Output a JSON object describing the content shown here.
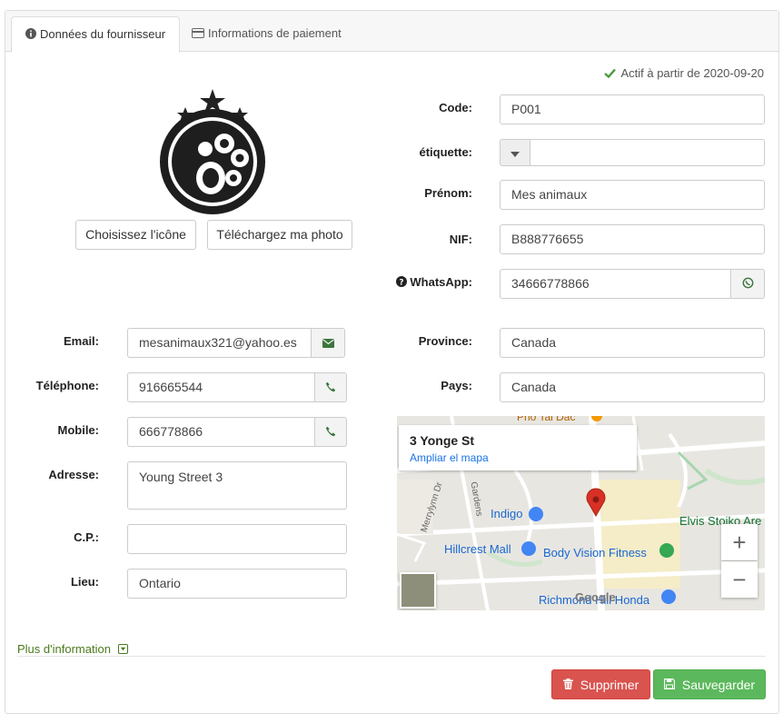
{
  "tabs": [
    {
      "label": "Données du fournisseur",
      "icon": "info-circle-icon",
      "active": true
    },
    {
      "label": "Informations de paiement",
      "icon": "credit-card-icon",
      "active": false
    }
  ],
  "status": {
    "text": "Actif à partir de 2020-09-20",
    "icon": "check-icon",
    "color": "#5cb85c"
  },
  "avatar": {
    "icon": "paw-star-logo-icon"
  },
  "photo_buttons": {
    "choose_icon": "Choisissez l'icône",
    "upload_photo": "Téléchargez ma photo"
  },
  "right_form": {
    "code": {
      "label": "Code:",
      "value": "P001"
    },
    "tag": {
      "label": "étiquette:",
      "value": ""
    },
    "firstname": {
      "label": "Prénom:",
      "value": "Mes animaux"
    },
    "nif": {
      "label": "NIF:",
      "value": "B888776655"
    },
    "whatsapp": {
      "label": "WhatsApp:",
      "value": "34666778866",
      "help_icon": "question-circle-icon",
      "icon": "whatsapp-icon"
    },
    "province": {
      "label": "Province:",
      "value": "Canada"
    },
    "country": {
      "label": "Pays:",
      "value": "Canada"
    }
  },
  "left_form": {
    "email": {
      "label": "Email:",
      "value": "mesanimaux321@yahoo.es",
      "icon": "envelope-icon"
    },
    "phone": {
      "label": "Téléphone:",
      "value": "916665544",
      "icon": "phone-icon"
    },
    "mobile": {
      "label": "Mobile:",
      "value": "666778866",
      "icon": "phone-icon"
    },
    "address": {
      "label": "Adresse:",
      "value": "Young Street 3"
    },
    "zip": {
      "label": "C.P.:",
      "value": ""
    },
    "city": {
      "label": "Lieu:",
      "value": "Ontario"
    }
  },
  "map": {
    "place_title": "3 Yonge St",
    "enlarge_link": "Ampliar el mapa",
    "labels": {
      "indigo": "Indigo",
      "hillcrest": "Hillcrest Mall",
      "body_vision": "Body Vision Fitness",
      "elvis": "Elvis Stoiko Are",
      "richmond": "Richmond Hill Honda",
      "merrylynn": "Merrylynn Dr",
      "garden": "Gardens",
      "pho": "Pho Tai Dac",
      "google": "Google"
    },
    "zoom_in": "+",
    "zoom_out": "−"
  },
  "more_info": {
    "label": "Plus d'information",
    "icon": "caret-down-square-icon"
  },
  "actions": {
    "delete": "Supprimer",
    "save": "Sauvegarder",
    "delete_color": "#d9534f",
    "save_color": "#5cb85c"
  }
}
